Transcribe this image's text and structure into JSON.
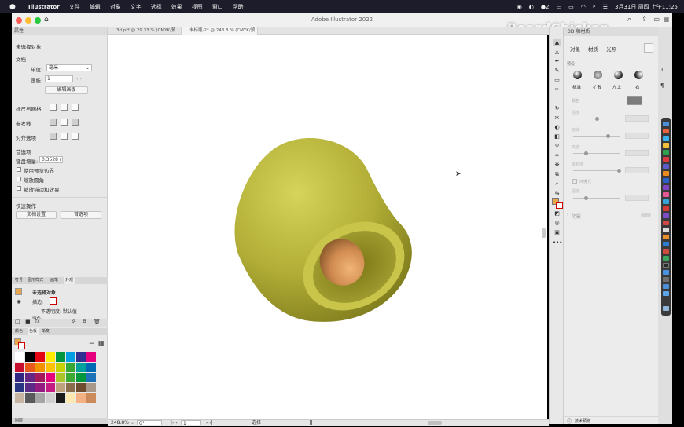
{
  "menubar": {
    "app": "Illustrator",
    "items": [
      "文件",
      "编辑",
      "对象",
      "文字",
      "选择",
      "效果",
      "视图",
      "窗口",
      "帮助"
    ],
    "datetime": "3月31日 周四 上午11:25",
    "badge": "2"
  },
  "window": {
    "title": "Adobe Illustrator 2022"
  },
  "watermark": "BeardChicken",
  "tabs": [
    {
      "label": "3d.pf* @ 29.33 % (CMYK/预览)"
    },
    {
      "label": "未标题-2* @ 248.8 % (CMYK/预览)"
    }
  ],
  "properties": {
    "header": "属性",
    "no_selection": "未选择对象",
    "document_title": "文档",
    "units_label": "单位:",
    "units_value": "毫米",
    "artboard_label": "画板:",
    "artboard_value": "1",
    "edit_artboards": "编辑画板",
    "rulers_grid": "标尺与网格",
    "guides": "参考线",
    "align_options": "对齐选项",
    "prefs_title": "首选项",
    "keyboard_increment_label": "键盘增量:",
    "keyboard_increment_value": "0.3528 r",
    "check_preview_bounds": "使用预览边界",
    "check_scale_corners": "缩放圆角",
    "check_scale_strokes": "缩放描边和效果",
    "quick_actions": "快速操作",
    "doc_setup": "文档设置",
    "preferences": "首选项"
  },
  "appearance": {
    "tabs": [
      "符号",
      "图形样式",
      "画笔",
      "外观"
    ],
    "no_selection": "未选择对象",
    "stroke_label": "描边:",
    "opacity_label": "不透明度: 默认值",
    "fill_label": "填色:"
  },
  "swatches": {
    "tabs": [
      "颜色",
      "色板",
      "渐变"
    ],
    "colors": [
      "#ffffff",
      "#000000",
      "#e30613",
      "#ffed00",
      "#009640",
      "#009fe3",
      "#2e3192",
      "#e6007e",
      "#c8102e",
      "#e85a1b",
      "#f39200",
      "#fdc300",
      "#c5d200",
      "#36a935",
      "#00a19a",
      "#0069b4",
      "#312783",
      "#662483",
      "#a3195b",
      "#e5007d",
      "#a8c62a",
      "#3aaa35",
      "#00983a",
      "#1d71b8",
      "#283583",
      "#5b2a86",
      "#951b81",
      "#c51a81",
      "#bea17d",
      "#8a6e4b",
      "#6d4c2f",
      "#a7988a",
      "#c6b5a3",
      "#58595b",
      "#a5a5a5",
      "#d0d0d0",
      "#1a1a1a",
      "#feeab0",
      "#f4b183",
      "#cc8b5b"
    ]
  },
  "bottom_panel": {
    "label": "图层"
  },
  "status": {
    "zoom": "248.8%",
    "angle": "0°",
    "artboard": "1",
    "tool": "选择"
  },
  "panel3d": {
    "title": "3D 和材质",
    "tabs": [
      "对象",
      "材质",
      "光照"
    ],
    "active_tab": "光照",
    "section": "预设",
    "presets": [
      "标准",
      "扩散",
      "左上",
      "右"
    ],
    "color_label": "颜色",
    "intensity_label": "强度",
    "rotation_label": "旋转",
    "height_label": "高度",
    "softness_label": "柔和度",
    "shadows_label": "环境光",
    "shadows2_label": "强度",
    "shadow_toggle": "阴影",
    "footer": "技术预览"
  },
  "colors": {
    "accent_swatch": "#e8a74a",
    "bell_body": "#b5b23a",
    "bell_inside": "#9f9a2a",
    "clapper": "#d9995c",
    "menubar": "#1c1c2a"
  }
}
